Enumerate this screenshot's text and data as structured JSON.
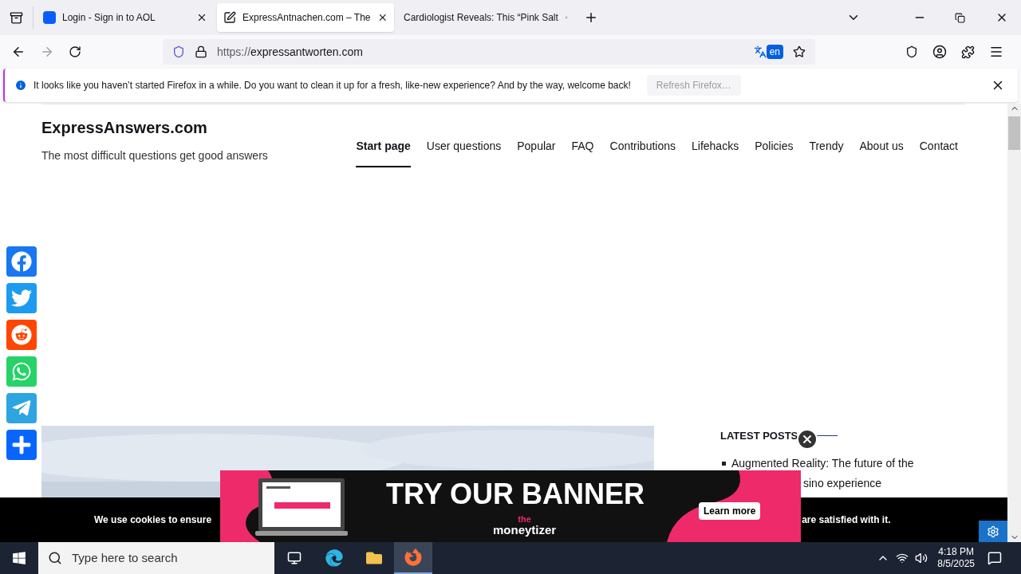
{
  "browser": {
    "tabs": [
      {
        "title": "Login - Sign in to AOL",
        "selected": false
      },
      {
        "title": "ExpressAntnachen.com – The",
        "selected": true
      },
      {
        "title": "Cardiologist Reveals: This “Pink Salt",
        "selected": false
      }
    ],
    "url_prefix": "https://",
    "url_host": "expressantworten.com",
    "translate_lang": "en",
    "notification": {
      "message": "It looks like you haven’t started Firefox in a while. Do you want to clean it up for a fresh, like-new experience? And by the way, welcome back!",
      "button": "Refresh Firefox…"
    }
  },
  "site": {
    "title": "ExpressAnswers.com",
    "tagline": "The most difficult questions get good answers",
    "nav": [
      {
        "label": "Start page",
        "selected": true
      },
      {
        "label": "User questions",
        "selected": false
      },
      {
        "label": "Popular",
        "selected": false
      },
      {
        "label": "FAQ",
        "selected": false
      },
      {
        "label": "Contributions",
        "selected": false
      },
      {
        "label": "Lifehacks",
        "selected": false
      },
      {
        "label": "Policies",
        "selected": false
      },
      {
        "label": "Trendy",
        "selected": false
      },
      {
        "label": "About us",
        "selected": false
      },
      {
        "label": "Contact",
        "selected": false
      }
    ],
    "share": [
      {
        "kind": "facebook",
        "color": "#1877f2"
      },
      {
        "kind": "twitter",
        "color": "#1d9bf0"
      },
      {
        "kind": "reddit",
        "color": "#ff4500"
      },
      {
        "kind": "whatsapp",
        "color": "#25d366"
      },
      {
        "kind": "telegram",
        "color": "#2ca5e0"
      },
      {
        "kind": "more",
        "color": "#0866ff"
      }
    ],
    "latest_posts": {
      "heading": "LATEST POSTS",
      "line_1": "Augmented Reality: The future of the",
      "line_2": "sino experience"
    },
    "cookie_bar": {
      "text_left": "We use cookies to ensure",
      "text_right": "are satisfied with it."
    },
    "banner": {
      "headline": "TRY OUR BANNER",
      "button": "Learn more",
      "logo_top": "the",
      "logo": "moneytizer"
    }
  },
  "taskbar": {
    "search_placeholder": "Type here to search",
    "time": "4:18 PM",
    "date": "8/5/2025"
  }
}
